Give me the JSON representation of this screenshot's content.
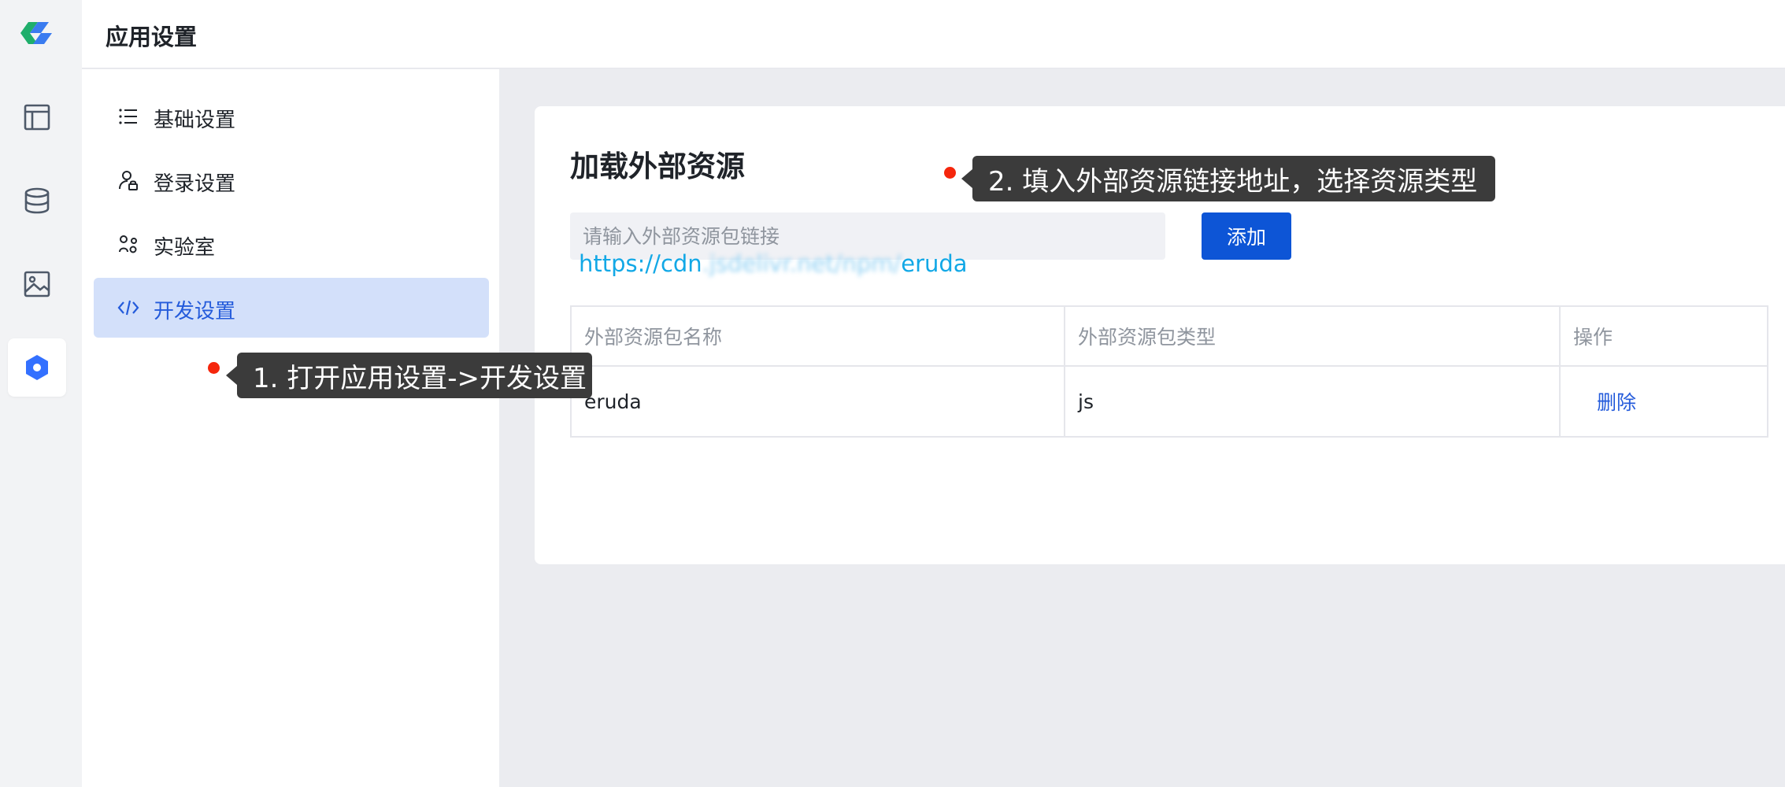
{
  "header": {
    "title": "应用设置"
  },
  "rail": {
    "icons": [
      "app-logo",
      "layout-icon",
      "database-icon",
      "image-icon",
      "hexagon-settings-icon"
    ],
    "active": "hexagon-settings-icon",
    "accent": "#3370ff"
  },
  "sidebar": {
    "items": [
      {
        "label": "基础设置",
        "icon": "list-icon"
      },
      {
        "label": "登录设置",
        "icon": "user-lock-icon"
      },
      {
        "label": "实验室",
        "icon": "lab-icon"
      },
      {
        "label": "开发设置",
        "icon": "code-icon",
        "active": true
      }
    ]
  },
  "card": {
    "title": "加载外部资源",
    "input": {
      "placeholder": "请输入外部资源包链接",
      "value": ""
    },
    "add_button": "添加",
    "url_hint": {
      "prefix": "https://cdn",
      "blurred": ".jsdelivr.net/npm/",
      "suffix": "eruda"
    },
    "table": {
      "columns": [
        "外部资源包名称",
        "外部资源包类型",
        "操作"
      ],
      "rows": [
        {
          "name": "eruda",
          "type": "js",
          "action": "删除"
        }
      ]
    }
  },
  "annotations": [
    {
      "text": "1. 打开应用设置->开发设置"
    },
    {
      "text": "2. 填入外部资源链接地址，选择资源类型"
    }
  ],
  "colors": {
    "primary": "#0d55d6",
    "link": "#245bdb",
    "active_nav_bg": "#d3e0fa",
    "tooltip_bg": "#3b3b3b",
    "marker": "#f5260c",
    "url_text": "#12a8e6"
  }
}
